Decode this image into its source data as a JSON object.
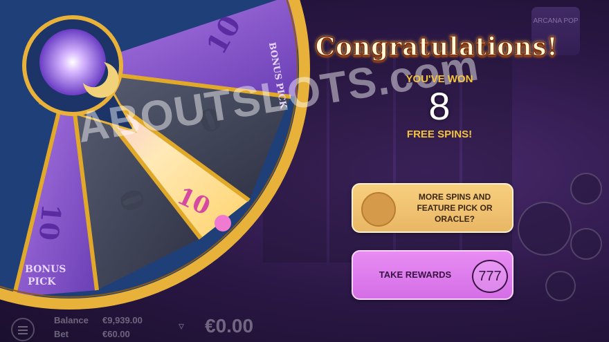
{
  "wheel": {
    "segments": [
      {
        "text": "10",
        "sub": "BONUS PICK"
      },
      {
        "text": "0"
      },
      {
        "text": "10"
      },
      {
        "text": "0"
      },
      {
        "text": "10",
        "sub": "BONUS PICK"
      }
    ]
  },
  "game_logo": "ARCANA POP",
  "popup": {
    "title": "Congratulations!",
    "won_label": "YOU'VE WON",
    "won_amount": "8",
    "won_unit": "FREE SPINS!"
  },
  "buttons": {
    "more": "MORE SPINS AND FEATURE PICK OR ORACLE?",
    "take": "TAKE REWARDS",
    "take_badge": "777"
  },
  "footer": {
    "balance_label": "Balance",
    "balance_value": "€9,939.00",
    "bet_label": "Bet",
    "bet_value": "€60.00",
    "win_value": "€0.00"
  },
  "watermark": "ABOUTSLOTS.com",
  "colors": {
    "accent_gold": "#f5c33b",
    "take_button": "#d46ee6",
    "more_button": "#e9b766"
  }
}
